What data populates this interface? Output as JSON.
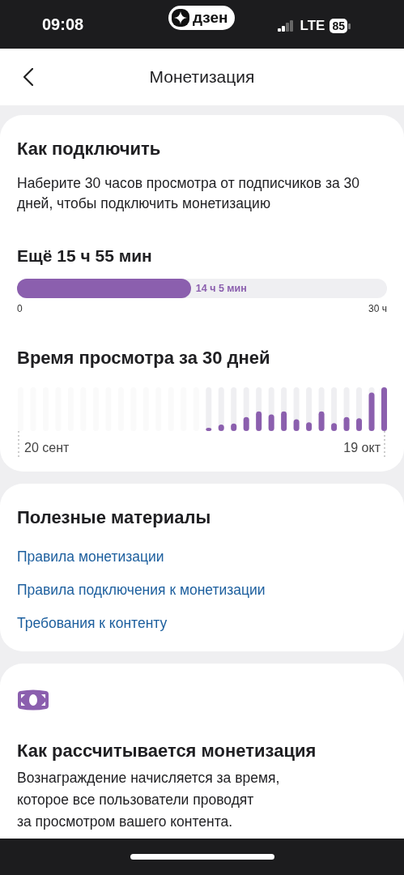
{
  "status_bar": {
    "time": "09:08",
    "app_badge": "дзен",
    "network": "LTE",
    "battery": "85"
  },
  "header": {
    "title": "Монетизация"
  },
  "connect_card": {
    "title": "Как подключить",
    "description": "Наберите 30 часов просмотра от подписчиков за 30 дней, чтобы подключить монетизацию",
    "remaining": "Ещё 15 ч 55 мин",
    "progress": {
      "level": 0.47,
      "value_label": "14 ч 5 мин",
      "min_label": "0",
      "max_label": "30 ч"
    },
    "watch_time": {
      "title": "Время просмотра за 30 дней",
      "start_label": "20 сент",
      "end_label": "19 окт"
    }
  },
  "materials_card": {
    "title": "Полезные материалы",
    "links": [
      "Правила монетизации",
      "Правила подключения к монетизации",
      "Требования к контенту"
    ]
  },
  "info_card": {
    "title": "Как рассчитывается монетизация",
    "text": "Вознаграждение начисляется за время,\nкоторое все пользователи проводят\nза просмотром вашего контента."
  }
}
